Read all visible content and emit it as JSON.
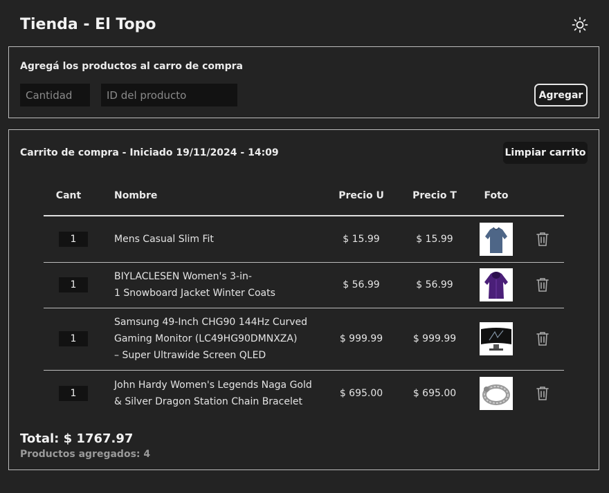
{
  "app": {
    "title": "Tienda - El Topo"
  },
  "add_form": {
    "title": "Agregá los productos al carro de compra",
    "quantity_placeholder": "Cantidad",
    "product_id_placeholder": "ID del producto",
    "add_label": "Agregar"
  },
  "cart": {
    "title": "Carrito de compra - Iniciado 19/11/2024 - 14:09",
    "clear_label": "Limpiar carrito",
    "columns": {
      "qty": "Cant",
      "name": "Nombre",
      "unit_price": "Precio U",
      "total_price": "Precio T",
      "photo": "Foto"
    },
    "rows": [
      {
        "qty": "1",
        "name": "Mens Casual Slim Fit",
        "name_lines": [
          "Mens Casual Slim Fit"
        ],
        "unit_price": "$ 15.99",
        "total_price": "$ 15.99",
        "photo_icon": "blue-shirt-photo"
      },
      {
        "qty": "1",
        "name": "BIYLACLESEN Women's 3-in-1 Snowboard Jacket Winter Coats",
        "name_lines": [
          "BIYLACLESEN Women's 3-in-",
          "1 Snowboard Jacket Winter Coats"
        ],
        "unit_price": "$ 56.99",
        "total_price": "$ 56.99",
        "photo_icon": "purple-jacket-photo"
      },
      {
        "qty": "1",
        "name": "Samsung 49-Inch CHG90 144Hz Curved Gaming Monitor (LC49HG90DMNXZA) – Super Ultrawide Screen QLED",
        "name_lines": [
          "Samsung 49-Inch CHG90 144Hz Curved",
          "Gaming Monitor (LC49HG90DMNXZA)",
          "– Super Ultrawide Screen QLED"
        ],
        "unit_price": "$ 999.99",
        "total_price": "$ 999.99",
        "photo_icon": "monitor-photo"
      },
      {
        "qty": "1",
        "name": "John Hardy Women's Legends Naga Gold & Silver Dragon Station Chain Bracelet",
        "name_lines": [
          "John Hardy Women's Legends Naga Gold",
          "& Silver Dragon Station Chain Bracelet"
        ],
        "unit_price": "$ 695.00",
        "total_price": "$ 695.00",
        "photo_icon": "bracelet-photo"
      }
    ],
    "total": "Total: $ 1767.97",
    "count": "Productos agregados: 4"
  },
  "colors": {
    "background": "#232323",
    "panel_border": "#bdbdbd",
    "input_bg": "#121212",
    "text": "#e6e6e6",
    "muted": "#9a9a9a"
  },
  "icons": {
    "theme": "sun-icon",
    "delete": "trash-icon"
  }
}
